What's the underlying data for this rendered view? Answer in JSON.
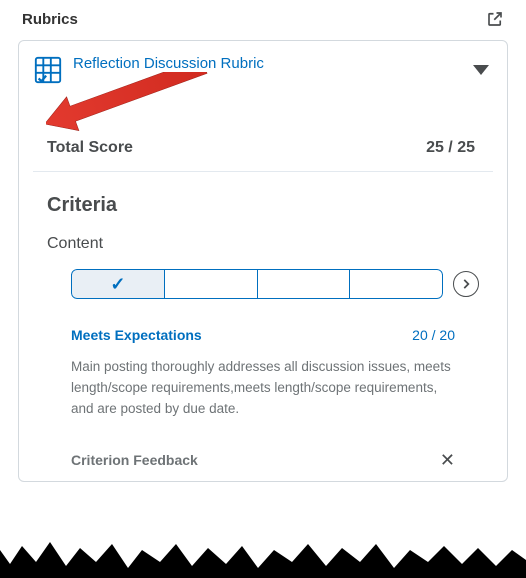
{
  "header": {
    "title": "Rubrics"
  },
  "rubric": {
    "title": "Reflection Discussion Rubric",
    "total_label": "Total Score",
    "total_value": "25 / 25",
    "criteria_heading": "Criteria"
  },
  "criterion": {
    "name": "Content",
    "level_name": "Meets Expectations",
    "level_score": "20 / 20",
    "level_description": "Main posting thoroughly addresses all discussion issues, meets length/scope requirements,meets length/scope requirements, and are posted by due date.",
    "feedback_label": "Criterion Feedback"
  }
}
